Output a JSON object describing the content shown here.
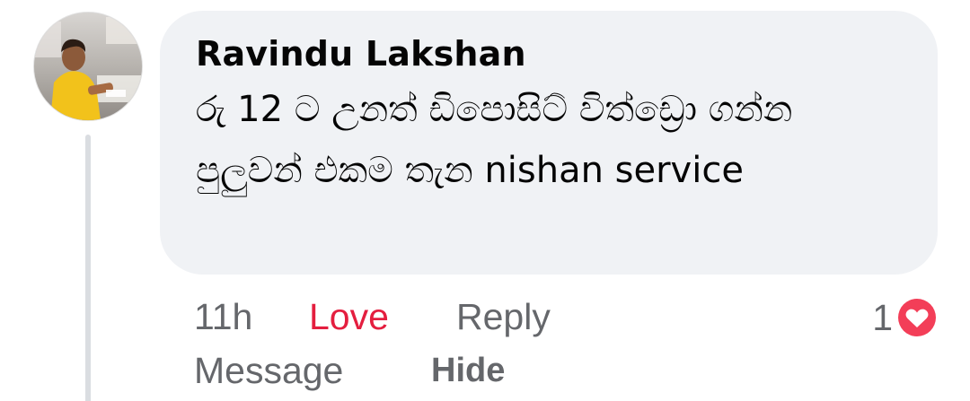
{
  "comment": {
    "author": "Ravindu Lakshan",
    "text": "රු 12 ට උනත් ඩිපොසිට් විත්ඩ්‍රො ගන්න පුලුවන් එකම තැන nishan service",
    "time": "11h",
    "love_label": "Love",
    "reply_label": "Reply",
    "reaction_count": "1",
    "reaction_icon": "love-heart-icon",
    "message_label": "Message",
    "hide_label": "Hide"
  },
  "colors": {
    "bubble_bg": "#f0f2f5",
    "love_red": "#e41e3f",
    "muted_text": "#65676b",
    "text": "#050505",
    "thread_line": "#dadde1"
  }
}
